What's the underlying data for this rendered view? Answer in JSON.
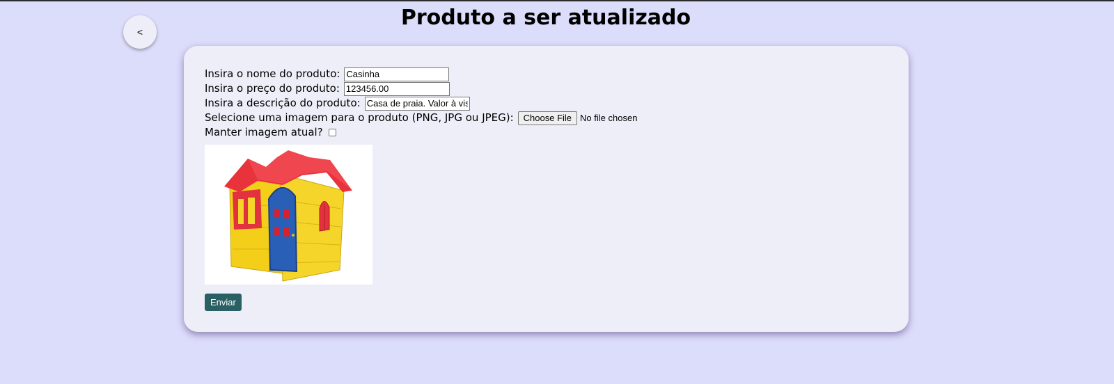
{
  "page": {
    "title": "Produto a ser atualizado",
    "back_label": "<"
  },
  "form": {
    "name_label": "Insira o nome do produto:",
    "name_value": "Casinha",
    "price_label": "Insira o preço do produto:",
    "price_value": "123456.00",
    "description_label": "Insira a descrição do produto:",
    "description_value": "Casa de praia. Valor à vis",
    "image_label": "Selecione uma imagem para o produto (PNG, JPG ou JPEG):",
    "file_button_label": "Choose File",
    "file_status": "No file chosen",
    "keep_image_label": "Manter imagem atual?",
    "keep_image_checked": false,
    "submit_label": "Enviar"
  },
  "colors": {
    "background": "#dcdcfb",
    "card": "#eeeef8",
    "submit": "#2a6064"
  }
}
